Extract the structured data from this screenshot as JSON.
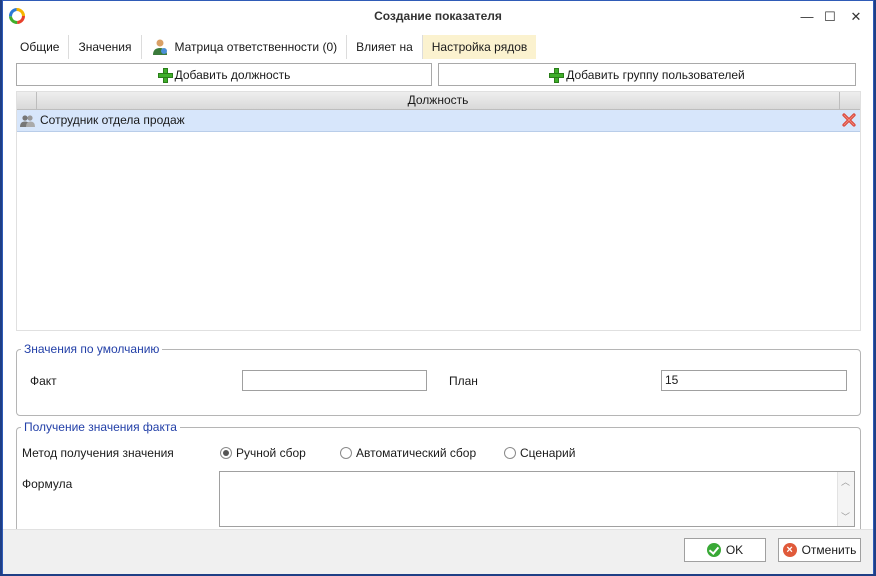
{
  "window": {
    "title": "Создание показателя",
    "minimize": "—",
    "maximize": "☐",
    "close": "✕"
  },
  "tabs": [
    {
      "label": "Общие"
    },
    {
      "label": "Значения"
    },
    {
      "label": "Матрица ответственности (0)"
    },
    {
      "label": "Влияет на"
    },
    {
      "label": "Настройка рядов"
    }
  ],
  "toolbar": {
    "add_position": "Добавить должность",
    "add_user_group": "Добавить группу пользователей"
  },
  "grid": {
    "column_header": "Должность",
    "rows": [
      {
        "label": "Сотрудник отдела продаж"
      }
    ]
  },
  "defaults": {
    "legend": "Значения по умолчанию",
    "fact_label": "Факт",
    "fact_value": "",
    "plan_label": "План",
    "plan_value": "15"
  },
  "fact_source": {
    "legend": "Получение значения факта",
    "method_label": "Метод получения значения",
    "options": [
      {
        "label": "Ручной сбор",
        "selected": true
      },
      {
        "label": "Автоматический сбор",
        "selected": false
      },
      {
        "label": "Сценарий",
        "selected": false
      }
    ],
    "formula_label": "Формула",
    "formula_value": ""
  },
  "footer": {
    "ok": "OK",
    "cancel": "Отменить"
  },
  "colors": {
    "accent": "#2340a8",
    "selected_row": "#d7e6fb",
    "active_tab": "#fbf2cf"
  }
}
